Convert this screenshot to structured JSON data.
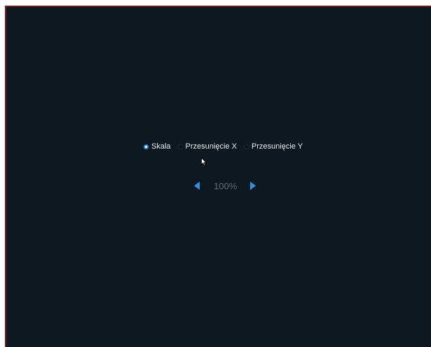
{
  "settings": {
    "options": [
      {
        "label": "Skala",
        "selected": true
      },
      {
        "label": "Przesunięcie X",
        "selected": false
      },
      {
        "label": "Przesunięcie Y",
        "selected": false
      }
    ],
    "value": "100%",
    "accent_color": "#2f8fe0",
    "background_color": "#0e1821"
  },
  "icons": {
    "decrease": "chevron-left-icon",
    "increase": "chevron-right-icon",
    "pointer": "mouse-pointer-icon"
  }
}
